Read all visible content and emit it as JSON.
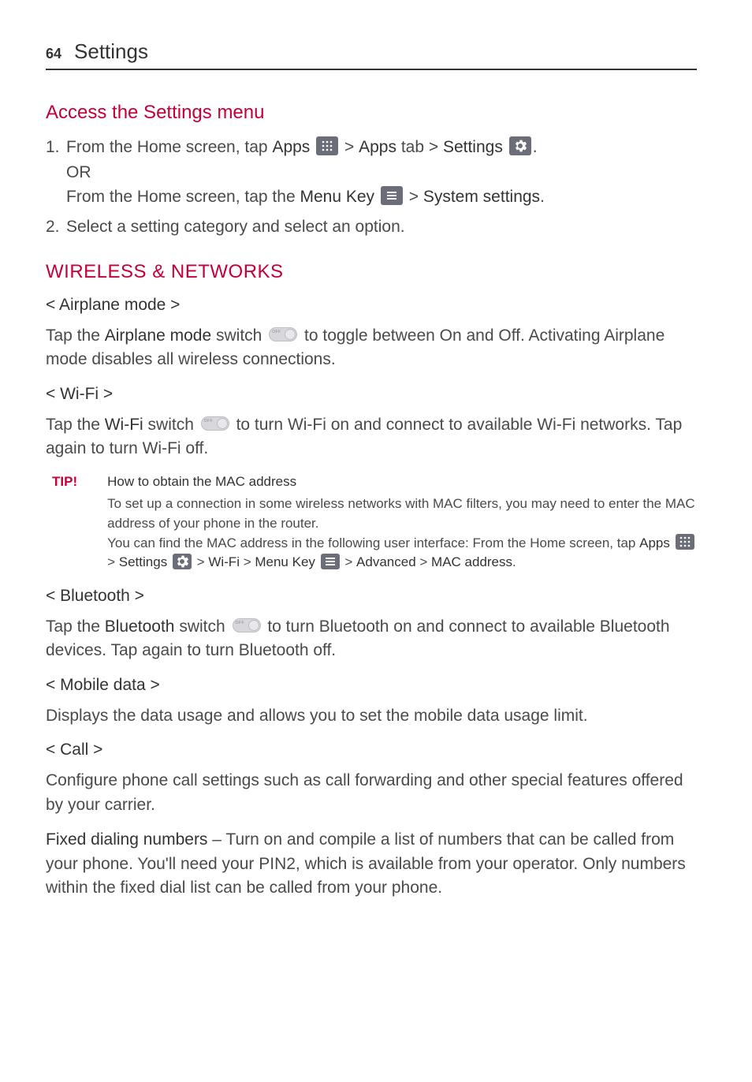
{
  "header": {
    "page_number": "64",
    "title": "Settings"
  },
  "h1": "Access the Settings menu",
  "steps": {
    "s1_num": "1.",
    "s1_a_pre": "From the Home screen, tap ",
    "s1_a_apps": "Apps",
    "s1_a_gt1": " > ",
    "s1_a_appstab": "Apps",
    "s1_a_tab": " tab > ",
    "s1_a_settings": "Settings",
    "s1_a_dot": ".",
    "s1_or": "OR",
    "s1_b_pre": "From the Home screen, tap the ",
    "s1_b_menukey": "Menu Key",
    "s1_b_gt": " > ",
    "s1_b_sys": "System settings",
    "s1_b_dot": ".",
    "s2_num": "2.",
    "s2_text": "Select a setting category and select an option."
  },
  "h2": "WIRELESS & NETWORKS",
  "airplane": {
    "h": "< Airplane mode >",
    "p1_pre": "Tap the ",
    "p1_bold": "Airplane mode",
    "p1_mid": " switch ",
    "p1_post": " to toggle between On and Off. Activating Airplane mode disables all wireless connections."
  },
  "wifi": {
    "h": "< Wi-Fi >",
    "p1_pre": "Tap the ",
    "p1_bold": "Wi-Fi",
    "p1_mid": " switch ",
    "p1_post": " to turn Wi-Fi on and connect to available Wi-Fi networks. Tap again to turn Wi-Fi off."
  },
  "tip": {
    "label": "TIP!",
    "title": "How to obtain the MAC address",
    "p1": "To set up a connection in some wireless networks with MAC filters, you may need to enter the MAC address of your phone in the router.",
    "p2_pre": "You can find the MAC address in the following user interface: From the Home screen, tap ",
    "apps": "Apps",
    "gt1": " > ",
    "settings": "Settings",
    "gt2": " > ",
    "wifi": "Wi-Fi",
    "gt3": " > ",
    "menukey": "Menu Key",
    "gt4": " > ",
    "advanced": "Advanced",
    "gt5": " > ",
    "mac": "MAC address",
    "dot": "."
  },
  "bluetooth": {
    "h": "< Bluetooth >",
    "p1_pre": "Tap the ",
    "p1_bold": "Bluetooth",
    "p1_mid": " switch ",
    "p1_post": " to turn Bluetooth on and connect to available Bluetooth devices. Tap again to turn Bluetooth off."
  },
  "mobiledata": {
    "h": "< Mobile data >",
    "p1": "Displays the data usage and allows you to set the mobile data usage limit."
  },
  "call": {
    "h": "< Call >",
    "p1": "Configure phone call settings such as call forwarding and other special features offered by your carrier.",
    "p2_bold": "Fixed dialing numbers",
    "p2_rest": " – Turn on and compile a list of numbers that can be called from your phone. You'll need your PIN2, which is available from your operator. Only numbers within the fixed dial list can be called from your phone."
  }
}
